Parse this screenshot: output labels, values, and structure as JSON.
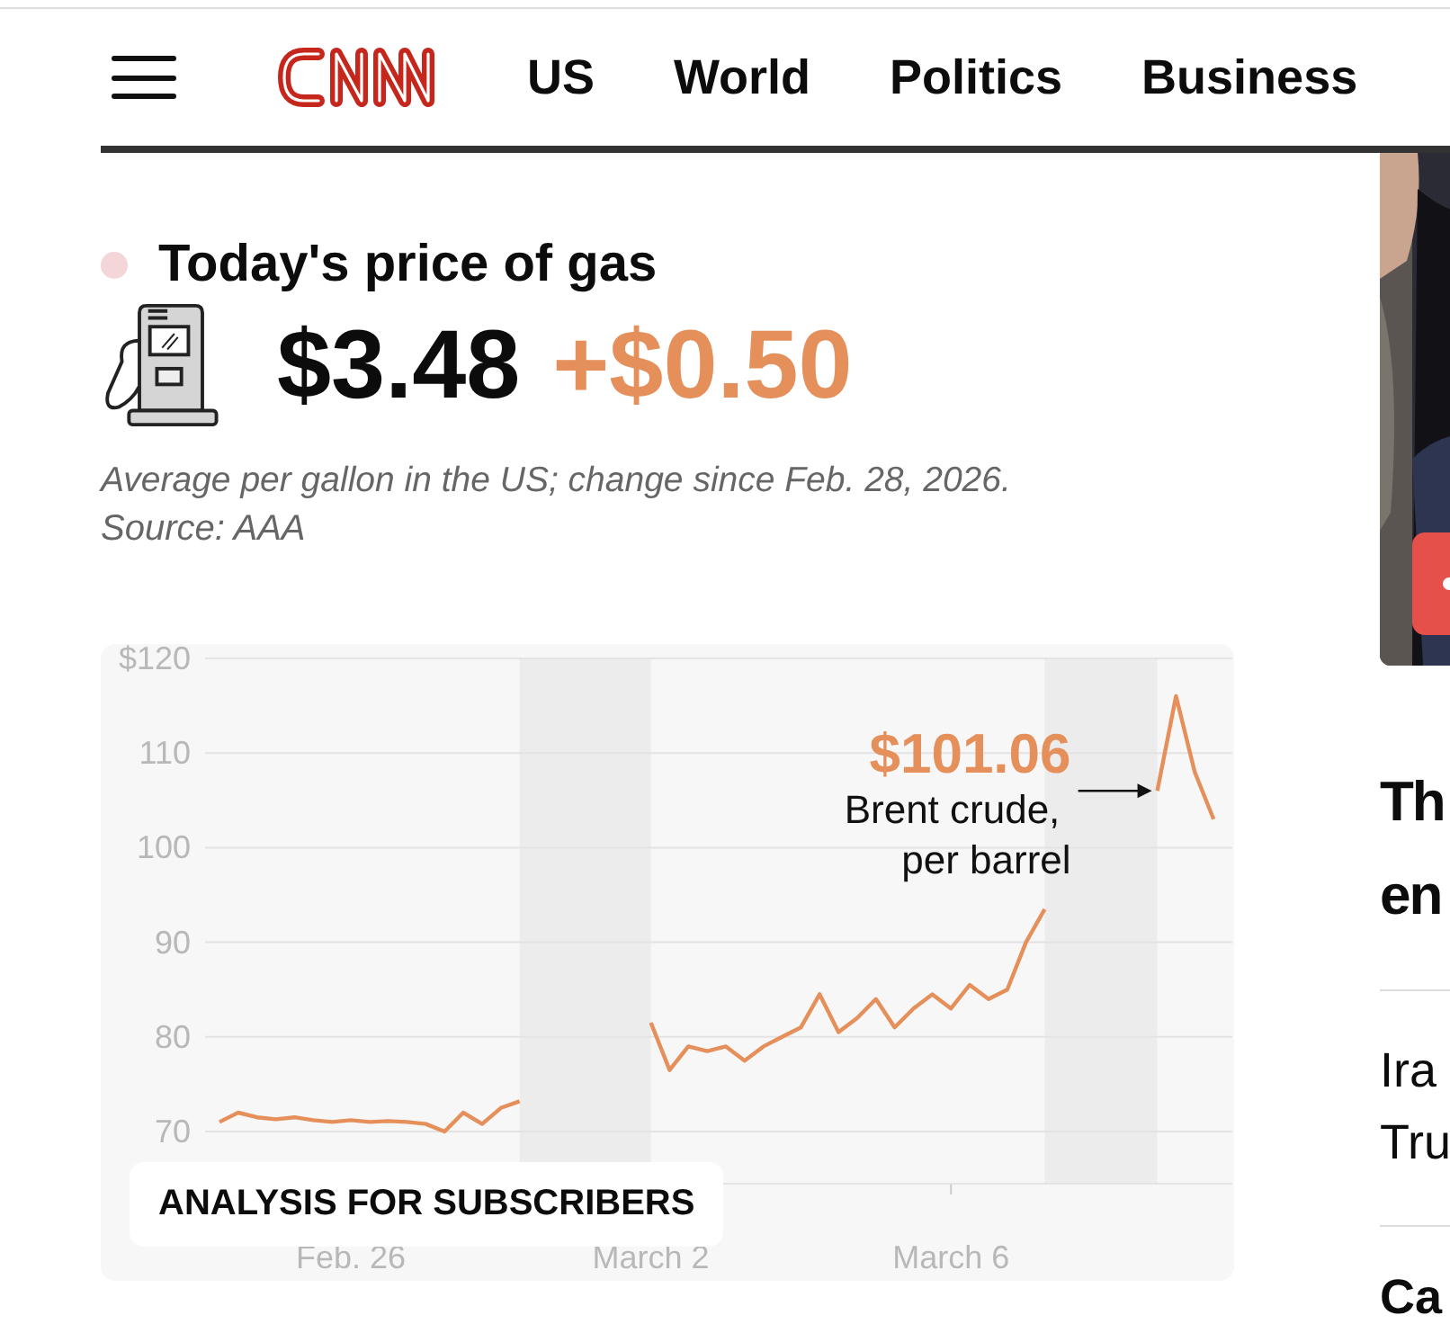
{
  "header": {
    "nav": [
      {
        "label": "US"
      },
      {
        "label": "World"
      },
      {
        "label": "Politics"
      },
      {
        "label": "Business"
      }
    ]
  },
  "gas": {
    "title": "Today's price of gas",
    "price": "$3.48",
    "change": "+$0.50",
    "caption": "Average per gallon in the US; change since Feb. 28, 2026.",
    "source": "Source: AAA"
  },
  "chart": {
    "badge": "ANALYSIS FOR SUBSCRIBERS",
    "chart_data": {
      "type": "line",
      "grid": true,
      "ylim": [
        70,
        120
      ],
      "yticks": [
        {
          "value": 120,
          "label": "$120"
        },
        70,
        80,
        90,
        100,
        110
      ],
      "categories": [
        null,
        null,
        null,
        null,
        null,
        null,
        null,
        "Feb. 26",
        null,
        null,
        null,
        null,
        null,
        null,
        null,
        null,
        null,
        null,
        null,
        null,
        null,
        null,
        null,
        "March 2",
        null,
        null,
        null,
        null,
        null,
        null,
        null,
        null,
        null,
        null,
        null,
        null,
        null,
        null,
        null,
        "March 6",
        null,
        null,
        null,
        null,
        null,
        null,
        null,
        null,
        null,
        null,
        null,
        null,
        null,
        null,
        null
      ],
      "series": [
        {
          "color": "#e58f5b",
          "values": [
            71,
            72,
            71.5,
            71.3,
            71.5,
            71.2,
            71,
            71.2,
            71,
            71.1,
            71,
            70.8,
            70,
            72,
            70.8,
            72.5,
            73.2,
            null,
            null,
            null,
            null,
            null,
            null,
            81.5,
            76.5,
            79,
            78.5,
            79,
            77.5,
            79,
            80,
            81,
            84.5,
            80.5,
            82,
            84,
            81,
            83,
            84.5,
            83,
            85.5,
            84,
            85,
            90,
            93.5,
            null,
            null,
            null,
            null,
            null,
            106,
            116,
            108,
            103,
            null
          ]
        }
      ],
      "annotations": [
        "$101.06",
        "Brent crude, per barrel"
      ]
    }
  },
  "sidebar": {
    "headline": [
      "Th",
      "en"
    ],
    "story": [
      "Ira",
      "Tru"
    ],
    "next": [
      "Ca"
    ]
  }
}
